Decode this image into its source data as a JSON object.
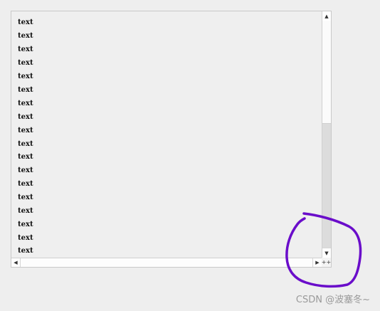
{
  "list": {
    "items": [
      "text",
      "text",
      "text",
      "text",
      "text",
      "text",
      "text",
      "text",
      "text",
      "text",
      "text",
      "text",
      "text",
      "text",
      "text",
      "text",
      "text",
      "text"
    ]
  },
  "scrollbars": {
    "up_arrow": "▲",
    "down_arrow": "▼",
    "left_arrow": "◀",
    "right_arrow": "▶",
    "corner_glyph": "++"
  },
  "annotation": {
    "shape": "freehand-circle",
    "color": "#6a0dca"
  },
  "watermark": {
    "text": "CSDN @波塞冬~"
  },
  "colors": {
    "background": "#eeeeee",
    "list_text": "#111111"
  }
}
